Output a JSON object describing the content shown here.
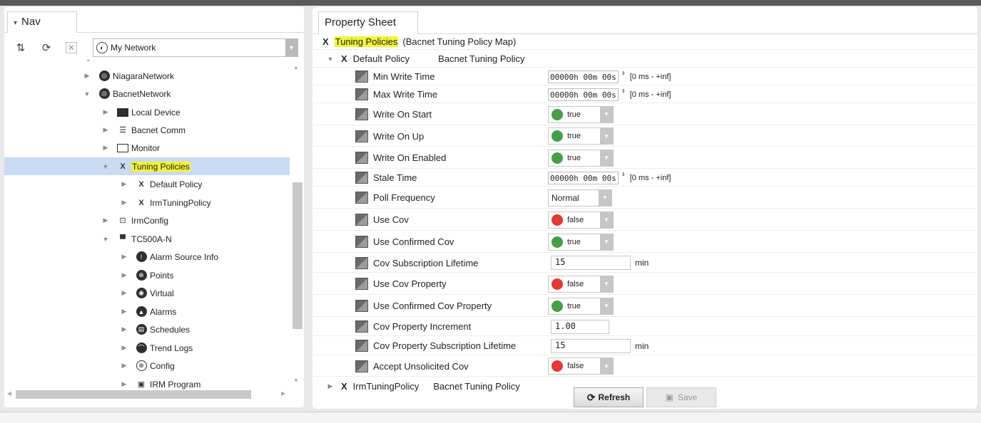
{
  "nav": {
    "tab_label": "Nav",
    "network_select": "My Network",
    "tree": [
      {
        "label": "NiagaraNetwork",
        "icon": "network-icon",
        "expanded": false,
        "depth": 1
      },
      {
        "label": "BacnetNetwork",
        "icon": "network-icon",
        "expanded": true,
        "depth": 1
      },
      {
        "label": "Local Device",
        "icon": "device-icon",
        "expanded": false,
        "depth": 2
      },
      {
        "label": "Bacnet Comm",
        "icon": "comm-icon",
        "expanded": false,
        "depth": 2
      },
      {
        "label": "Monitor",
        "icon": "monitor-icon",
        "expanded": false,
        "depth": 2
      },
      {
        "label": "Tuning Policies",
        "icon": "tuning-icon",
        "expanded": true,
        "depth": 2,
        "selected": true
      },
      {
        "label": "Default Policy",
        "icon": "tuning-icon",
        "expanded": false,
        "depth": 3
      },
      {
        "label": "IrmTuningPolicy",
        "icon": "tuning-icon",
        "expanded": false,
        "depth": 3
      },
      {
        "label": "IrmConfig",
        "icon": "config-icon",
        "expanded": false,
        "depth": 2
      },
      {
        "label": "TC500A-N",
        "icon": "controller-icon",
        "expanded": true,
        "depth": 2
      },
      {
        "label": "Alarm Source Info",
        "icon": "alarm-source-icon",
        "expanded": false,
        "depth": 3
      },
      {
        "label": "Points",
        "icon": "points-icon",
        "expanded": false,
        "depth": 3
      },
      {
        "label": "Virtual",
        "icon": "virtual-icon",
        "expanded": false,
        "depth": 3
      },
      {
        "label": "Alarms",
        "icon": "alarms-icon",
        "expanded": false,
        "depth": 3
      },
      {
        "label": "Schedules",
        "icon": "schedules-icon",
        "expanded": false,
        "depth": 3
      },
      {
        "label": "Trend Logs",
        "icon": "trend-logs-icon",
        "expanded": false,
        "depth": 3
      },
      {
        "label": "Config",
        "icon": "config-globe-icon",
        "expanded": false,
        "depth": 3
      },
      {
        "label": "IRM Program",
        "icon": "program-icon",
        "expanded": false,
        "depth": 3
      }
    ]
  },
  "property_sheet": {
    "tab_label": "Property Sheet",
    "root": {
      "name": "Tuning Policies",
      "type": "(Bacnet Tuning Policy Map)"
    },
    "default_policy": {
      "name": "Default Policy",
      "type": "Bacnet Tuning Policy"
    },
    "properties": [
      {
        "label": "Min Write Time",
        "kind": "duration",
        "value": "00000h 00m 00s",
        "range": "[0 ms - +inf]"
      },
      {
        "label": "Max Write Time",
        "kind": "duration",
        "value": "00000h 00m 00s",
        "range": "[0 ms - +inf]"
      },
      {
        "label": "Write On Start",
        "kind": "bool",
        "value": "true"
      },
      {
        "label": "Write On Up",
        "kind": "bool",
        "value": "true"
      },
      {
        "label": "Write On Enabled",
        "kind": "bool",
        "value": "true"
      },
      {
        "label": "Stale Time",
        "kind": "duration",
        "value": "00000h 00m 00s",
        "range": "[0 ms - +inf]"
      },
      {
        "label": "Poll Frequency",
        "kind": "select",
        "value": "Normal"
      },
      {
        "label": "Use Cov",
        "kind": "bool",
        "value": "false"
      },
      {
        "label": "Use Confirmed Cov",
        "kind": "bool",
        "value": "true"
      },
      {
        "label": "Cov Subscription Lifetime",
        "kind": "number",
        "value": "15",
        "unit": "min"
      },
      {
        "label": "Use Cov Property",
        "kind": "bool",
        "value": "false"
      },
      {
        "label": "Use Confirmed Cov Property",
        "kind": "bool",
        "value": "true"
      },
      {
        "label": "Cov Property Increment",
        "kind": "number",
        "value": "1.00",
        "unit": ""
      },
      {
        "label": "Cov Property Subscription Lifetime",
        "kind": "number",
        "value": "15",
        "unit": "min"
      },
      {
        "label": "Accept Unsolicited Cov",
        "kind": "bool",
        "value": "false"
      }
    ],
    "irm_policy": {
      "name": "IrmTuningPolicy",
      "type": "Bacnet Tuning Policy"
    },
    "refresh_label": "Refresh",
    "save_label": "Save"
  },
  "colors": {
    "true_dot": "#43a047",
    "false_dot": "#e53935",
    "selection": "#c9daf3",
    "highlight": "#f3f338"
  }
}
